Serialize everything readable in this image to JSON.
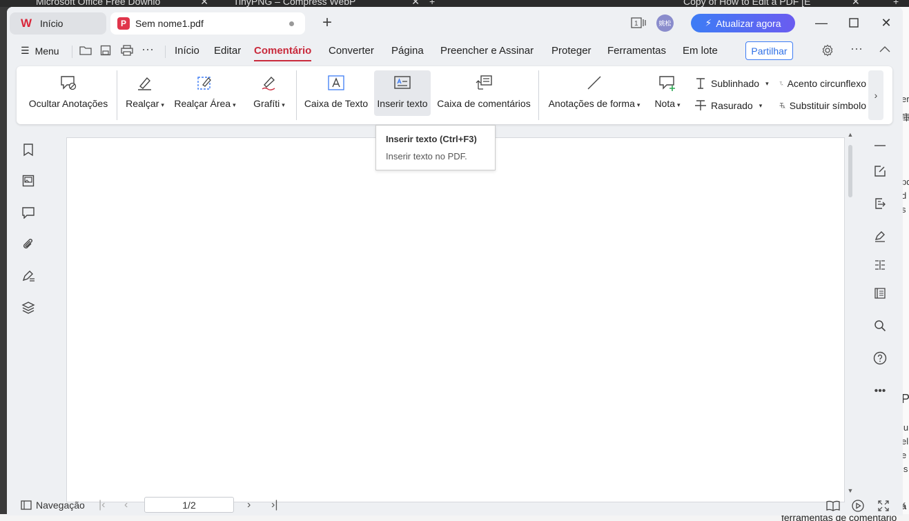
{
  "browser_tabs": [
    {
      "label": "Microsoft Office Free Downlo"
    },
    {
      "label": "TinyPNG – Compress WebP"
    },
    {
      "label": "Copy of How to Edit a PDF [E"
    }
  ],
  "background_right_text": [
    "ers",
    "庫",
    "pd",
    "d",
    "s",
    "P",
    "lu",
    "el",
    "e",
    "is",
    "á"
  ],
  "background_bottom_text": "ferramentas de comentário",
  "titlebar": {
    "home_tab": "Início",
    "doc_tab": "Sem nome1.pdf",
    "avatar_text": "姚松",
    "upgrade_label": "Atualizar agora"
  },
  "menubar": {
    "menu_label": "Menu",
    "items": [
      "Início",
      "Editar",
      "Comentário",
      "Converter",
      "Página",
      "Preencher e Assinar",
      "Proteger",
      "Ferramentas",
      "Em lote"
    ],
    "active": "Comentário",
    "share_label": "Partilhar"
  },
  "ribbon": {
    "hide_annotations": "Ocultar Anotações",
    "highlight": "Realçar",
    "highlight_area": "Realçar Área",
    "graffiti": "Grafíti",
    "text_box": "Caixa de Texto",
    "insert_text": "Inserir texto",
    "comment_box": "Caixa de comentários",
    "shape_annotations": "Anotações de forma",
    "note": "Nota",
    "underline": "Sublinhado",
    "strikethrough": "Rasurado",
    "caret": "Acento circunflexo",
    "replace_symbol": "Substituir símbolo"
  },
  "tooltip": {
    "title": "Inserir texto (Ctrl+F3)",
    "description": "Inserir texto no PDF."
  },
  "statusbar": {
    "navigation_label": "Navegação",
    "page_value": "1/2"
  },
  "colors": {
    "accent": "#c92a3c",
    "upgrade_start": "#3d7cf5",
    "upgrade_end": "#6a5cf0",
    "share_border": "#3d7cf5"
  }
}
